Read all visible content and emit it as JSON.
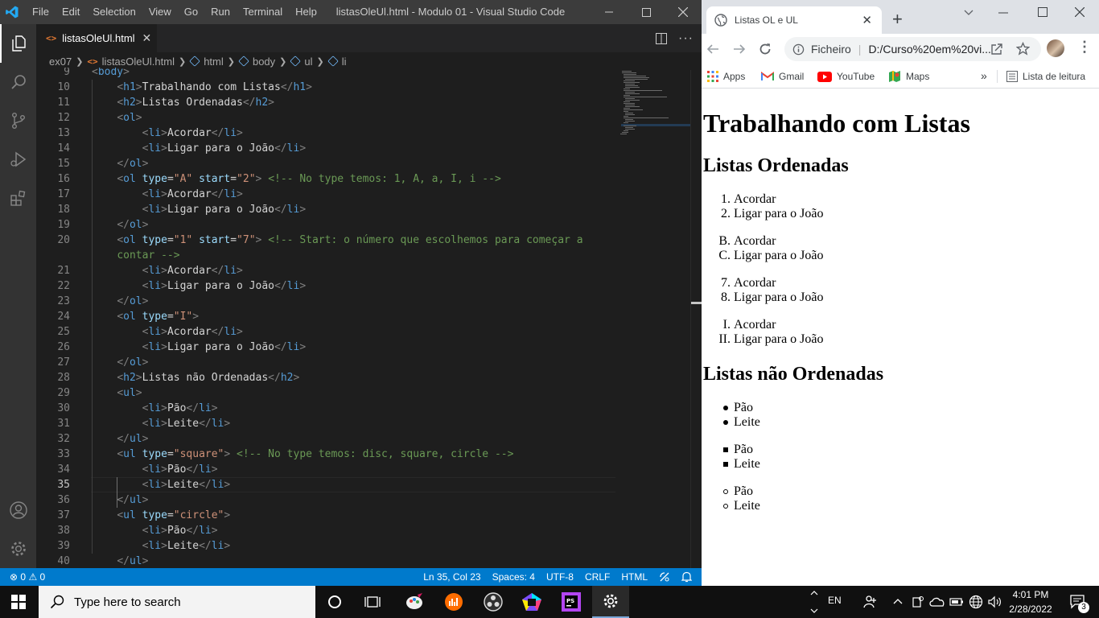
{
  "vscode": {
    "menu": [
      "File",
      "Edit",
      "Selection",
      "View",
      "Go",
      "Run",
      "Terminal",
      "Help"
    ],
    "title": "listasOleUl.html - Modulo 01 - Visual Studio Code",
    "tab_label": "listasOleUl.html",
    "breadcrumbs": [
      "ex07",
      "listasOleUl.html",
      "html",
      "body",
      "ul",
      "li"
    ],
    "lines": [
      {
        "n": "9",
        "parts": [
          [
            "tg",
            "<"
          ],
          [
            "tn",
            "body"
          ],
          [
            "tg",
            ">"
          ]
        ]
      },
      {
        "n": "10",
        "indent": "    ",
        "parts": [
          [
            "tg",
            "<"
          ],
          [
            "tn",
            "h1"
          ],
          [
            "tg",
            ">"
          ],
          [
            "tx",
            "Trabalhando com Listas"
          ],
          [
            "tg",
            "</"
          ],
          [
            "tn",
            "h1"
          ],
          [
            "tg",
            ">"
          ]
        ]
      },
      {
        "n": "11",
        "indent": "    ",
        "parts": [
          [
            "tg",
            "<"
          ],
          [
            "tn",
            "h2"
          ],
          [
            "tg",
            ">"
          ],
          [
            "tx",
            "Listas Ordenadas"
          ],
          [
            "tg",
            "</"
          ],
          [
            "tn",
            "h2"
          ],
          [
            "tg",
            ">"
          ]
        ]
      },
      {
        "n": "12",
        "indent": "    ",
        "parts": [
          [
            "tg",
            "<"
          ],
          [
            "tn",
            "ol"
          ],
          [
            "tg",
            ">"
          ]
        ]
      },
      {
        "n": "13",
        "indent": "        ",
        "parts": [
          [
            "tg",
            "<"
          ],
          [
            "tn",
            "li"
          ],
          [
            "tg",
            ">"
          ],
          [
            "tx",
            "Acordar"
          ],
          [
            "tg",
            "</"
          ],
          [
            "tn",
            "li"
          ],
          [
            "tg",
            ">"
          ]
        ]
      },
      {
        "n": "14",
        "indent": "        ",
        "parts": [
          [
            "tg",
            "<"
          ],
          [
            "tn",
            "li"
          ],
          [
            "tg",
            ">"
          ],
          [
            "tx",
            "Ligar para o João"
          ],
          [
            "tg",
            "</"
          ],
          [
            "tn",
            "li"
          ],
          [
            "tg",
            ">"
          ]
        ]
      },
      {
        "n": "15",
        "indent": "    ",
        "parts": [
          [
            "tg",
            "</"
          ],
          [
            "tn",
            "ol"
          ],
          [
            "tg",
            ">"
          ]
        ]
      },
      {
        "n": "16",
        "indent": "    ",
        "parts": [
          [
            "tg",
            "<"
          ],
          [
            "tn",
            "ol"
          ],
          [
            "tx",
            " "
          ],
          [
            "at",
            "type"
          ],
          [
            "tx",
            "="
          ],
          [
            "av",
            "\"A\""
          ],
          [
            "tx",
            " "
          ],
          [
            "at",
            "start"
          ],
          [
            "tx",
            "="
          ],
          [
            "av",
            "\"2\""
          ],
          [
            "tg",
            ">"
          ],
          [
            "tx",
            " "
          ],
          [
            "cm",
            "<!-- No type temos: 1, A, a, I, i -->"
          ]
        ]
      },
      {
        "n": "17",
        "indent": "        ",
        "parts": [
          [
            "tg",
            "<"
          ],
          [
            "tn",
            "li"
          ],
          [
            "tg",
            ">"
          ],
          [
            "tx",
            "Acordar"
          ],
          [
            "tg",
            "</"
          ],
          [
            "tn",
            "li"
          ],
          [
            "tg",
            ">"
          ]
        ]
      },
      {
        "n": "18",
        "indent": "        ",
        "parts": [
          [
            "tg",
            "<"
          ],
          [
            "tn",
            "li"
          ],
          [
            "tg",
            ">"
          ],
          [
            "tx",
            "Ligar para o João"
          ],
          [
            "tg",
            "</"
          ],
          [
            "tn",
            "li"
          ],
          [
            "tg",
            ">"
          ]
        ]
      },
      {
        "n": "19",
        "indent": "    ",
        "parts": [
          [
            "tg",
            "</"
          ],
          [
            "tn",
            "ol"
          ],
          [
            "tg",
            ">"
          ]
        ]
      },
      {
        "n": "20",
        "indent": "    ",
        "parts": [
          [
            "tg",
            "<"
          ],
          [
            "tn",
            "ol"
          ],
          [
            "tx",
            " "
          ],
          [
            "at",
            "type"
          ],
          [
            "tx",
            "="
          ],
          [
            "av",
            "\"1\""
          ],
          [
            "tx",
            " "
          ],
          [
            "at",
            "start"
          ],
          [
            "tx",
            "="
          ],
          [
            "av",
            "\"7\""
          ],
          [
            "tg",
            ">"
          ],
          [
            "tx",
            " "
          ],
          [
            "cm",
            "<!-- Start: o número que escolhemos para começar a"
          ]
        ]
      },
      {
        "n": "",
        "indent": "    ",
        "parts": [
          [
            "cm",
            "contar -->"
          ]
        ]
      },
      {
        "n": "21",
        "indent": "        ",
        "parts": [
          [
            "tg",
            "<"
          ],
          [
            "tn",
            "li"
          ],
          [
            "tg",
            ">"
          ],
          [
            "tx",
            "Acordar"
          ],
          [
            "tg",
            "</"
          ],
          [
            "tn",
            "li"
          ],
          [
            "tg",
            ">"
          ]
        ]
      },
      {
        "n": "22",
        "indent": "        ",
        "parts": [
          [
            "tg",
            "<"
          ],
          [
            "tn",
            "li"
          ],
          [
            "tg",
            ">"
          ],
          [
            "tx",
            "Ligar para o João"
          ],
          [
            "tg",
            "</"
          ],
          [
            "tn",
            "li"
          ],
          [
            "tg",
            ">"
          ]
        ]
      },
      {
        "n": "23",
        "indent": "    ",
        "parts": [
          [
            "tg",
            "</"
          ],
          [
            "tn",
            "ol"
          ],
          [
            "tg",
            ">"
          ]
        ]
      },
      {
        "n": "24",
        "indent": "    ",
        "parts": [
          [
            "tg",
            "<"
          ],
          [
            "tn",
            "ol"
          ],
          [
            "tx",
            " "
          ],
          [
            "at",
            "type"
          ],
          [
            "tx",
            "="
          ],
          [
            "av",
            "\"I\""
          ],
          [
            "tg",
            ">"
          ]
        ]
      },
      {
        "n": "25",
        "indent": "        ",
        "parts": [
          [
            "tg",
            "<"
          ],
          [
            "tn",
            "li"
          ],
          [
            "tg",
            ">"
          ],
          [
            "tx",
            "Acordar"
          ],
          [
            "tg",
            "</"
          ],
          [
            "tn",
            "li"
          ],
          [
            "tg",
            ">"
          ]
        ]
      },
      {
        "n": "26",
        "indent": "        ",
        "parts": [
          [
            "tg",
            "<"
          ],
          [
            "tn",
            "li"
          ],
          [
            "tg",
            ">"
          ],
          [
            "tx",
            "Ligar para o João"
          ],
          [
            "tg",
            "</"
          ],
          [
            "tn",
            "li"
          ],
          [
            "tg",
            ">"
          ]
        ]
      },
      {
        "n": "27",
        "indent": "    ",
        "parts": [
          [
            "tg",
            "</"
          ],
          [
            "tn",
            "ol"
          ],
          [
            "tg",
            ">"
          ]
        ]
      },
      {
        "n": "28",
        "indent": "    ",
        "parts": [
          [
            "tg",
            "<"
          ],
          [
            "tn",
            "h2"
          ],
          [
            "tg",
            ">"
          ],
          [
            "tx",
            "Listas não Ordenadas"
          ],
          [
            "tg",
            "</"
          ],
          [
            "tn",
            "h2"
          ],
          [
            "tg",
            ">"
          ]
        ]
      },
      {
        "n": "29",
        "indent": "    ",
        "parts": [
          [
            "tg",
            "<"
          ],
          [
            "tn",
            "ul"
          ],
          [
            "tg",
            ">"
          ]
        ]
      },
      {
        "n": "30",
        "indent": "        ",
        "parts": [
          [
            "tg",
            "<"
          ],
          [
            "tn",
            "li"
          ],
          [
            "tg",
            ">"
          ],
          [
            "tx",
            "Pão"
          ],
          [
            "tg",
            "</"
          ],
          [
            "tn",
            "li"
          ],
          [
            "tg",
            ">"
          ]
        ]
      },
      {
        "n": "31",
        "indent": "        ",
        "parts": [
          [
            "tg",
            "<"
          ],
          [
            "tn",
            "li"
          ],
          [
            "tg",
            ">"
          ],
          [
            "tx",
            "Leite"
          ],
          [
            "tg",
            "</"
          ],
          [
            "tn",
            "li"
          ],
          [
            "tg",
            ">"
          ]
        ]
      },
      {
        "n": "32",
        "indent": "    ",
        "parts": [
          [
            "tg",
            "</"
          ],
          [
            "tn",
            "ul"
          ],
          [
            "tg",
            ">"
          ]
        ]
      },
      {
        "n": "33",
        "indent": "    ",
        "parts": [
          [
            "tg",
            "<"
          ],
          [
            "tn",
            "ul"
          ],
          [
            "tx",
            " "
          ],
          [
            "at",
            "type"
          ],
          [
            "tx",
            "="
          ],
          [
            "av",
            "\"square\""
          ],
          [
            "tg",
            ">"
          ],
          [
            "tx",
            " "
          ],
          [
            "cm",
            "<!-- No type temos: disc, square, circle -->"
          ]
        ]
      },
      {
        "n": "34",
        "indent": "        ",
        "parts": [
          [
            "tg",
            "<"
          ],
          [
            "tn",
            "li"
          ],
          [
            "tg",
            ">"
          ],
          [
            "tx",
            "Pão"
          ],
          [
            "tg",
            "</"
          ],
          [
            "tn",
            "li"
          ],
          [
            "tg",
            ">"
          ]
        ]
      },
      {
        "n": "35",
        "indent": "        ",
        "active": true,
        "parts": [
          [
            "tg",
            "<"
          ],
          [
            "tn",
            "li"
          ],
          [
            "tg",
            ">"
          ],
          [
            "tx",
            "Leite"
          ],
          [
            "tg",
            "</"
          ],
          [
            "tn",
            "li"
          ],
          [
            "tg",
            ">"
          ]
        ]
      },
      {
        "n": "36",
        "indent": "    ",
        "parts": [
          [
            "tg",
            "</"
          ],
          [
            "tn",
            "ul"
          ],
          [
            "tg",
            ">"
          ]
        ]
      },
      {
        "n": "37",
        "indent": "    ",
        "parts": [
          [
            "tg",
            "<"
          ],
          [
            "tn",
            "ul"
          ],
          [
            "tx",
            " "
          ],
          [
            "at",
            "type"
          ],
          [
            "tx",
            "="
          ],
          [
            "av",
            "\"circle\""
          ],
          [
            "tg",
            ">"
          ]
        ]
      },
      {
        "n": "38",
        "indent": "        ",
        "parts": [
          [
            "tg",
            "<"
          ],
          [
            "tn",
            "li"
          ],
          [
            "tg",
            ">"
          ],
          [
            "tx",
            "Pão"
          ],
          [
            "tg",
            "</"
          ],
          [
            "tn",
            "li"
          ],
          [
            "tg",
            ">"
          ]
        ]
      },
      {
        "n": "39",
        "indent": "        ",
        "parts": [
          [
            "tg",
            "<"
          ],
          [
            "tn",
            "li"
          ],
          [
            "tg",
            ">"
          ],
          [
            "tx",
            "Leite"
          ],
          [
            "tg",
            "</"
          ],
          [
            "tn",
            "li"
          ],
          [
            "tg",
            ">"
          ]
        ]
      },
      {
        "n": "40",
        "indent": "    ",
        "parts": [
          [
            "tg",
            "</"
          ],
          [
            "tn",
            "ul"
          ],
          [
            "tg",
            ">"
          ]
        ]
      }
    ],
    "status": {
      "errors": "0",
      "warnings": "0",
      "position": "Ln 35, Col 23",
      "spaces": "Spaces: 4",
      "encoding": "UTF-8",
      "eol": "CRLF",
      "language": "HTML"
    },
    "colors": {
      "accent": "#007acc",
      "background": "#1e1e1e"
    }
  },
  "chrome": {
    "tab_title": "Listas OL e UL",
    "omnibox_label": "Ficheiro",
    "omnibox_url": "D:/Curso%20em%20vi...",
    "bookmarks": [
      "Apps",
      "Gmail",
      "YouTube",
      "Maps"
    ],
    "reading_list": "Lista de leitura",
    "page": {
      "h1": "Trabalhando com Listas",
      "h2_ordered": "Listas Ordenadas",
      "ordered_lists": [
        {
          "markers": [
            "1.",
            "2."
          ],
          "items": [
            "Acordar",
            "Ligar para o João"
          ]
        },
        {
          "markers": [
            "B.",
            "C."
          ],
          "items": [
            "Acordar",
            "Ligar para o João"
          ]
        },
        {
          "markers": [
            "7.",
            "8."
          ],
          "items": [
            "Acordar",
            "Ligar para o João"
          ]
        },
        {
          "markers": [
            "I.",
            "II."
          ],
          "items": [
            "Acordar",
            "Ligar para o João"
          ]
        }
      ],
      "h2_unordered": "Listas não Ordenadas",
      "unordered_lists": [
        {
          "style": "disc",
          "items": [
            "Pão",
            "Leite"
          ]
        },
        {
          "style": "square",
          "items": [
            "Pão",
            "Leite"
          ]
        },
        {
          "style": "circle",
          "items": [
            "Pão",
            "Leite"
          ]
        }
      ]
    }
  },
  "taskbar": {
    "search_placeholder": "Type here to search",
    "language": "EN",
    "time": "4:01 PM",
    "date": "2/28/2022",
    "notifications": "3"
  }
}
